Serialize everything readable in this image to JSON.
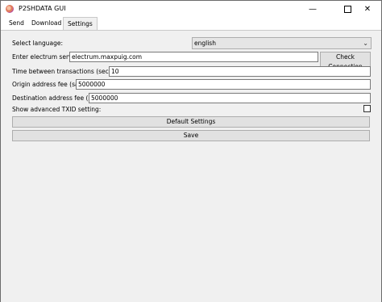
{
  "window": {
    "title": "P2SHDATA GUI",
    "controls": {
      "minimize": "—",
      "close": "✕"
    }
  },
  "tabs": [
    {
      "label": "Send"
    },
    {
      "label": "Download"
    },
    {
      "label": "Settings",
      "active": true
    }
  ],
  "settings": {
    "language": {
      "label": "Select language:",
      "value": "english",
      "chevron": "⌄"
    },
    "electrum": {
      "label": "Enter electrum server:",
      "value": "electrum.maxpuig.com",
      "button": "Check Connection"
    },
    "time_between": {
      "label": "Time between transactions (seconds):",
      "value": "10"
    },
    "origin_fee": {
      "label": "Origin address fee (sats):",
      "value": "5000000"
    },
    "destination_fee": {
      "label": "Destination address fee (sats):",
      "value": "5000000"
    },
    "advanced_txid": {
      "label": "Show advanced TXID setting:",
      "checked": false
    },
    "default_button": "Default Settings",
    "save_button": "Save"
  }
}
